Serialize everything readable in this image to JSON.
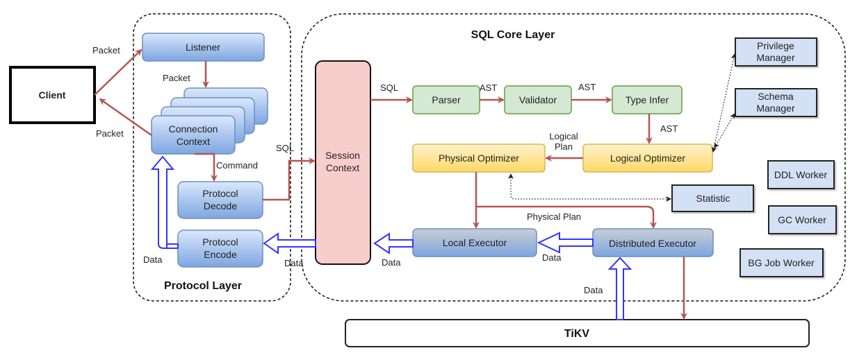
{
  "client": {
    "label": "Client"
  },
  "protocol_layer": {
    "title": "Protocol Layer",
    "listener": "Listener",
    "connection_context": [
      "Connection",
      "Context"
    ],
    "protocol_decode": [
      "Protocol",
      "Decode"
    ],
    "protocol_encode": [
      "Protocol",
      "Encode"
    ]
  },
  "session_context": [
    "Session",
    "Context"
  ],
  "sql_core_layer": {
    "title": "SQL Core Layer",
    "parser": "Parser",
    "validator": "Validator",
    "type_infer": "Type Infer",
    "logical_optimizer": "Logical Optimizer",
    "physical_optimizer": "Physical Optimizer",
    "local_executor": "Local Executor",
    "distributed_executor": "Distributed Executor",
    "privilege_manager": [
      "Privilege",
      "Manager"
    ],
    "schema_manager": [
      "Schema",
      "Manager"
    ],
    "statistic": "Statistic",
    "ddl_worker": "DDL Worker",
    "gc_worker": "GC Worker",
    "bg_job_worker": "BG Job Worker"
  },
  "tikv": {
    "label": "TiKV"
  },
  "edge_labels": {
    "packet_in": "Packet",
    "packet_out": "Packet",
    "packet_internal": "Packet",
    "command": "Command",
    "sql_to_session": "SQL",
    "sql_to_parser": "SQL",
    "ast1": "AST",
    "ast2": "AST",
    "ast3": "AST",
    "logical_plan": [
      "Logical",
      "Plan"
    ],
    "physical_plan": "Physical Plan",
    "data_encode": "Data",
    "data_session": "Data",
    "data_local": "Data",
    "data_dist": "Data",
    "data_tikv": "Data"
  },
  "colors": {
    "blue_box_top": "#dae8fc",
    "blue_box_bottom": "#7ea6e0",
    "blue_border": "#6c8ebf",
    "green_fill": "#d5e8d4",
    "green_border": "#82b366",
    "yellow_top": "#fff2cc",
    "yellow_bottom": "#ffd966",
    "yellow_border": "#d6b656",
    "session_fill": "#f8cecc",
    "red_arrow": "#b85450",
    "data_arrow": "#3333ff",
    "manager_fill": "#d4e1f5"
  }
}
